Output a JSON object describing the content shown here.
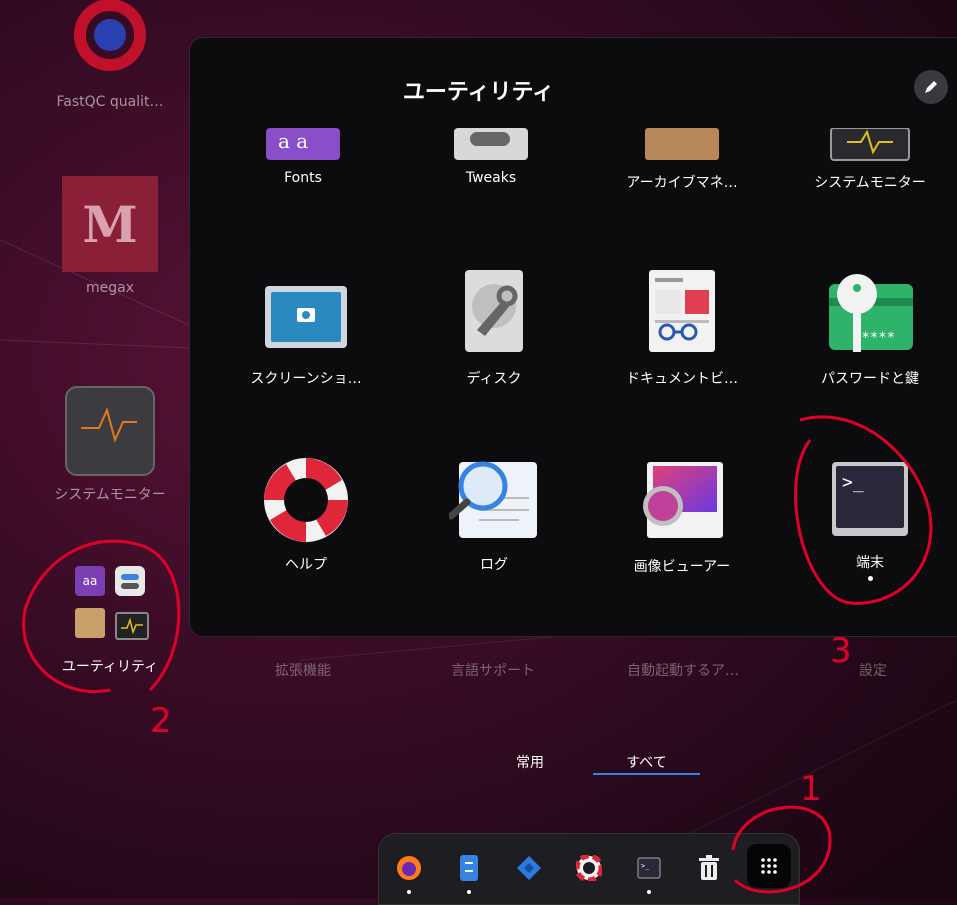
{
  "folder": {
    "title": "ユーティリティ",
    "apps": [
      {
        "label": "Fonts",
        "icon": "fonts-icon"
      },
      {
        "label": "Tweaks",
        "icon": "tweaks-icon"
      },
      {
        "label": "アーカイブマネ…",
        "icon": "archive-manager-icon"
      },
      {
        "label": "システムモニター",
        "icon": "system-monitor-icon"
      },
      {
        "label": "スクリーンショ…",
        "icon": "screenshot-icon"
      },
      {
        "label": "ディスク",
        "icon": "disks-icon"
      },
      {
        "label": "ドキュメントビ…",
        "icon": "document-viewer-icon"
      },
      {
        "label": "パスワードと鍵",
        "icon": "passwords-keys-icon"
      },
      {
        "label": "ヘルプ",
        "icon": "help-icon"
      },
      {
        "label": "ログ",
        "icon": "logs-icon"
      },
      {
        "label": "画像ビューアー",
        "icon": "image-viewer-icon"
      },
      {
        "label": "端末",
        "icon": "terminal-icon"
      }
    ]
  },
  "background_apps": [
    {
      "label": "FastQC qualit…"
    },
    {
      "label": "megax"
    },
    {
      "label": "システムモニター"
    },
    {
      "label": "ユーティリティ"
    },
    {
      "label": "拡張機能"
    },
    {
      "label": "言語サポート"
    },
    {
      "label": "自動起動するア…"
    },
    {
      "label": "設定"
    }
  ],
  "tabs": {
    "frequent": "常用",
    "all": "すべて"
  },
  "dock": [
    {
      "name": "firefox-icon"
    },
    {
      "name": "files-icon"
    },
    {
      "name": "vscode-icon"
    },
    {
      "name": "help-icon"
    },
    {
      "name": "terminal-icon"
    },
    {
      "name": "trash-icon"
    },
    {
      "name": "app-grid-icon"
    }
  ],
  "annotations": [
    "1",
    "2",
    "3"
  ],
  "colors": {
    "accent": "#3584e4",
    "annotation": "#e0002a"
  }
}
